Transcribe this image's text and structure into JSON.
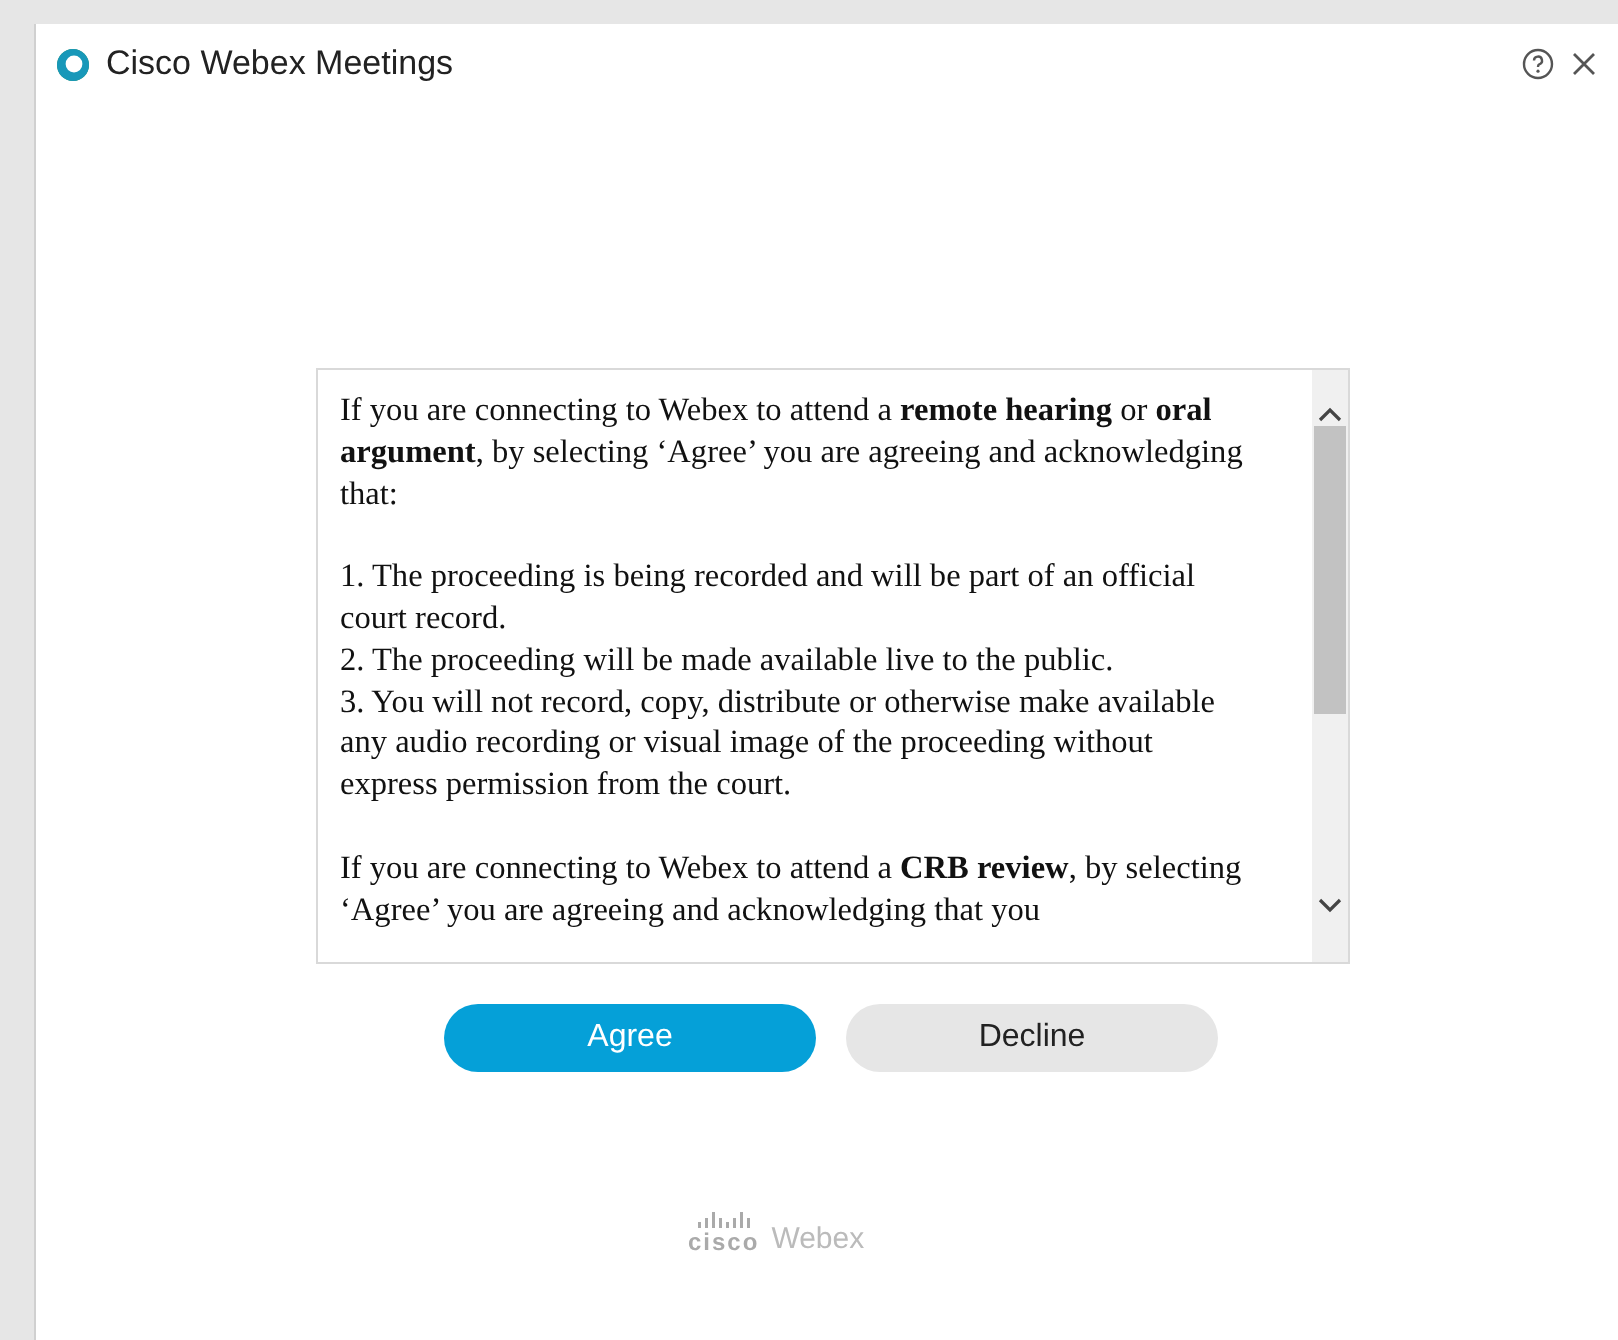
{
  "window": {
    "title": "Cisco Webex Meetings"
  },
  "agreement": {
    "blocks": [
      {
        "kind": "paragraph",
        "text": "If you are connecting to Webex to attend a **remote hearing** or **oral argument**, by selecting ‘Agree’ you are agreeing and acknowledging that:"
      },
      {
        "kind": "item",
        "text": "1. The proceeding is being recorded and will be part of an official court record."
      },
      {
        "kind": "item",
        "text": "2. The proceeding will be made available live to the public."
      },
      {
        "kind": "item",
        "text": "3. You will not record, copy, distribute or otherwise make available any audio recording or visual image of the proceeding without express permission from the court."
      },
      {
        "kind": "paragraph",
        "text": "If you are connecting to Webex to attend a **CRB review**, by selecting ‘Agree’ you are agreeing and acknowledging that you"
      }
    ]
  },
  "buttons": [
    {
      "label": "Agree",
      "kind": "primary"
    },
    {
      "label": "Decline",
      "kind": "secondary"
    }
  ],
  "footer": {
    "brand": "cisco",
    "product": "Webex"
  }
}
